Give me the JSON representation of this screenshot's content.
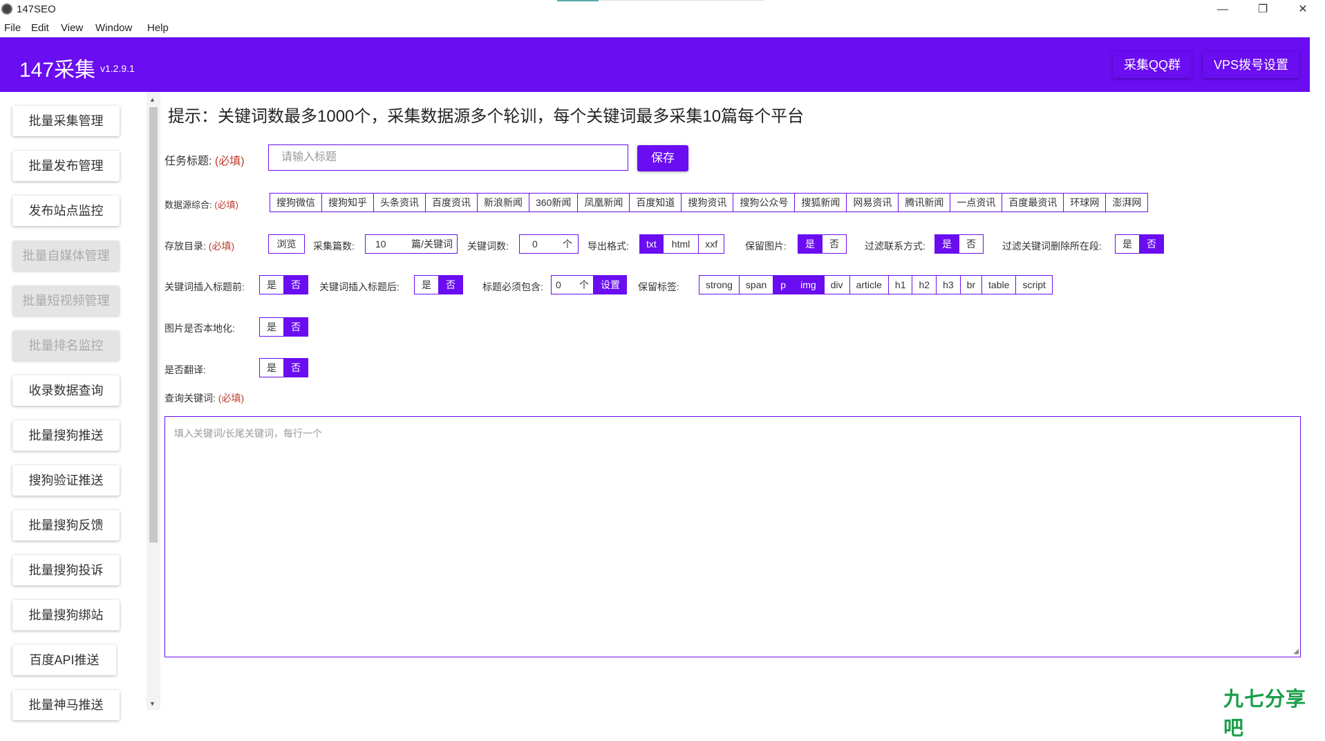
{
  "window": {
    "title": "147SEO",
    "minimize": "—",
    "maximize": "❐",
    "close": "✕"
  },
  "menu": [
    "File",
    "Edit",
    "View",
    "Window",
    "Help"
  ],
  "header": {
    "brand": "147采集",
    "version": "v1.2.9.1",
    "qq_group": "采集QQ群",
    "vps_settings": "VPS拨号设置"
  },
  "sidebar": {
    "items": [
      {
        "label": "批量采集管理",
        "state": "active"
      },
      {
        "label": "批量发布管理",
        "state": "normal"
      },
      {
        "label": "发布站点监控",
        "state": "normal"
      },
      {
        "label": "批量自媒体管理",
        "state": "disabled"
      },
      {
        "label": "批量短视频管理",
        "state": "disabled"
      },
      {
        "label": "批量排名监控",
        "state": "disabled"
      },
      {
        "label": "收录数据查询",
        "state": "normal"
      },
      {
        "label": "批量搜狗推送",
        "state": "normal"
      },
      {
        "label": "搜狗验证推送",
        "state": "normal"
      },
      {
        "label": "批量搜狗反馈",
        "state": "normal"
      },
      {
        "label": "批量搜狗投诉",
        "state": "normal"
      },
      {
        "label": "批量搜狗绑站",
        "state": "normal"
      },
      {
        "label": "百度API推送",
        "state": "normal"
      },
      {
        "label": "批量神马推送",
        "state": "normal"
      }
    ]
  },
  "main": {
    "tip": "提示：关键词数最多1000个，采集数据源多个轮训，每个关键词最多采集10篇每个平台",
    "required": "(必填)",
    "task_title": {
      "label": "任务标题:",
      "placeholder": "请输入标题",
      "save": "保存"
    },
    "sources": {
      "label": "数据源综合:",
      "items": [
        "搜狗微信",
        "搜狗知乎",
        "头条资讯",
        "百度资讯",
        "新浪新闻",
        "360新闻",
        "凤凰新闻",
        "百度知道",
        "搜狗资讯",
        "搜狗公众号",
        "搜狐新闻",
        "网易资讯",
        "腾讯新闻",
        "一点资讯",
        "百度最资讯",
        "环球网",
        "澎湃网"
      ]
    },
    "row3": {
      "dir_label": "存放目录:",
      "browse": "浏览",
      "count_label": "采集篇数:",
      "count_value": "10",
      "count_unit": "篇/关键词",
      "kw_count_label": "关键词数:",
      "kw_count_value": "0",
      "kw_count_unit": "个",
      "export_label": "导出格式:",
      "export_options": [
        "txt",
        "html",
        "xxf"
      ],
      "export_selected": "txt",
      "keep_img_label": "保留图片:",
      "filter_contact_label": "过滤联系方式:",
      "filter_kw_label": "过滤关键词删除所在段:"
    },
    "row4": {
      "kw_before_label": "关键词插入标题前:",
      "kw_after_label": "关键词插入标题后:",
      "title_must_label": "标题必须包含:",
      "title_must_value": "0",
      "title_must_unit": "个",
      "set": "设置",
      "keep_tags_label": "保留标签:",
      "tags": [
        "strong",
        "span",
        "p",
        "img",
        "div",
        "article",
        "h1",
        "h2",
        "h3",
        "br",
        "table",
        "script"
      ],
      "tags_selected": [
        "p",
        "img"
      ]
    },
    "localize_label": "图片是否本地化:",
    "translate_label": "是否翻译:",
    "yes": "是",
    "no": "否",
    "query_label": "查询关键词:",
    "query_placeholder": "填入关键词/长尾关键词，每行一个"
  },
  "watermark": "九七分享吧",
  "colors": {
    "accent": "#6a0df0",
    "required": "#c0392b",
    "watermark": "#1a9e4a"
  }
}
